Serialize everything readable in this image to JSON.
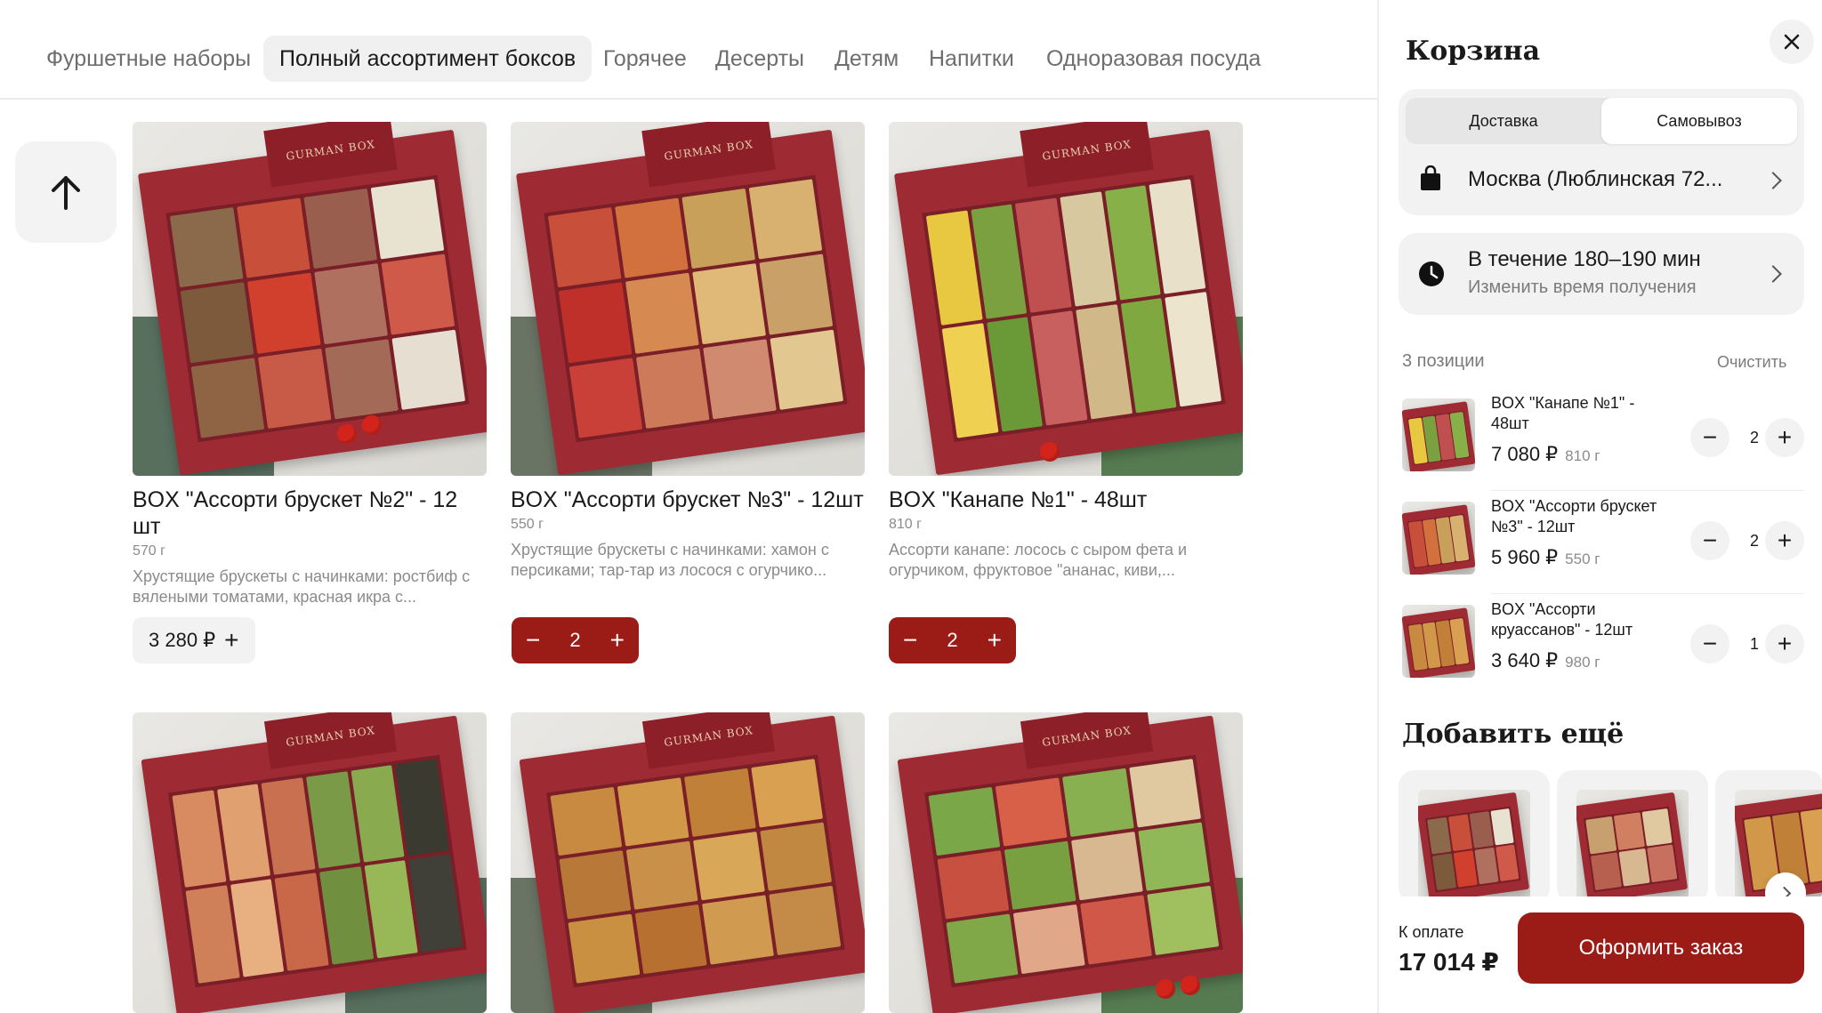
{
  "nav": {
    "tabs": [
      {
        "label": "Фуршетные наборы"
      },
      {
        "label": "Полный ассортимент боксов"
      },
      {
        "label": "Горячее"
      },
      {
        "label": "Десерты"
      },
      {
        "label": "Детям"
      },
      {
        "label": "Напитки"
      },
      {
        "label": "Одноразовая посуда"
      }
    ],
    "active_tab": "Полный ассортимент боксов"
  },
  "products": [
    {
      "title": "BOX \"Ассорти брускет №2\" - 12 шт",
      "weight": "570 г",
      "description": "Хрустящие брускеты с начинками: ростбиф с вялеными томатами, красная икра с...",
      "price": "3 280 ₽",
      "in_cart_qty": null
    },
    {
      "title": "BOX \"Ассорти брускет №3\" - 12шт",
      "weight": "550 г",
      "description": "Хрустящие брускеты с начинками: хамон с персиками; тар-тар из лосося с огурчико...",
      "price": null,
      "in_cart_qty": "2"
    },
    {
      "title": "BOX \"Канапе №1\" - 48шт",
      "weight": "810 г",
      "description": "Ассорти канапе: лосось с сыром фета и огурчиком, фруктовое \"ананас, киви,...",
      "price": null,
      "in_cart_qty": "2"
    },
    {
      "title": "",
      "weight": "",
      "description": "",
      "price": null,
      "in_cart_qty": null
    },
    {
      "title": "",
      "weight": "",
      "description": "",
      "price": null,
      "in_cart_qty": null
    },
    {
      "title": "",
      "weight": "",
      "description": "",
      "price": null,
      "in_cart_qty": null
    }
  ],
  "box_brand": "GURMAN BOX",
  "cart": {
    "title": "Корзина",
    "delivery_tab": "Доставка",
    "pickup_tab": "Самовывоз",
    "selected_mode": "Самовывоз",
    "address": "Москва (Люблинская 72...",
    "time_title": "В течение 180–190 мин",
    "time_sub": "Изменить время получения",
    "positions_label": "3 позиции",
    "clear_label": "Очистить",
    "items": [
      {
        "name": "BOX \"Канапе №1\" - 48шт",
        "price": "7 080 ₽",
        "weight": "810 г",
        "qty": "2"
      },
      {
        "name": "BOX \"Ассорти брускет №3\" - 12шт",
        "price": "5 960 ₽",
        "weight": "550 г",
        "qty": "2"
      },
      {
        "name": "BOX \"Ассорти круассанов\" - 12шт",
        "price": "3 640 ₽",
        "weight": "980 г",
        "qty": "1"
      }
    ],
    "add_more_title": "Добавить ещё",
    "total_label": "К оплате",
    "total_value": "17 014 ₽",
    "checkout_label": "Оформить заказ"
  },
  "colors": {
    "accent": "#9b1c17",
    "box_red": "#9e2b33",
    "text_muted": "#8b8b8b"
  }
}
